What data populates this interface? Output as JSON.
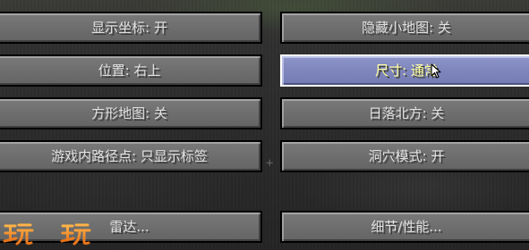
{
  "menu": {
    "left": [
      {
        "label": "显示坐标: 开"
      },
      {
        "label": "位置: 右上"
      },
      {
        "label": "方形地图: 关"
      },
      {
        "label": "游戏内路径点: 只显示标签"
      },
      {
        "label": "雷达..."
      }
    ],
    "right": [
      {
        "label": "隐藏小地图: 关"
      },
      {
        "label": "尺寸: 通常"
      },
      {
        "label": "日落北方: 关"
      },
      {
        "label": "洞穴模式: 开"
      },
      {
        "label": "细节/性能..."
      }
    ]
  },
  "watermark": {
    "text": "玩一玩"
  },
  "colors": {
    "button_text": "#e0e0e0",
    "hover_text": "#ffffa0",
    "hover_bg": "#7e86bd",
    "button_bg": "#6e6e6e"
  }
}
